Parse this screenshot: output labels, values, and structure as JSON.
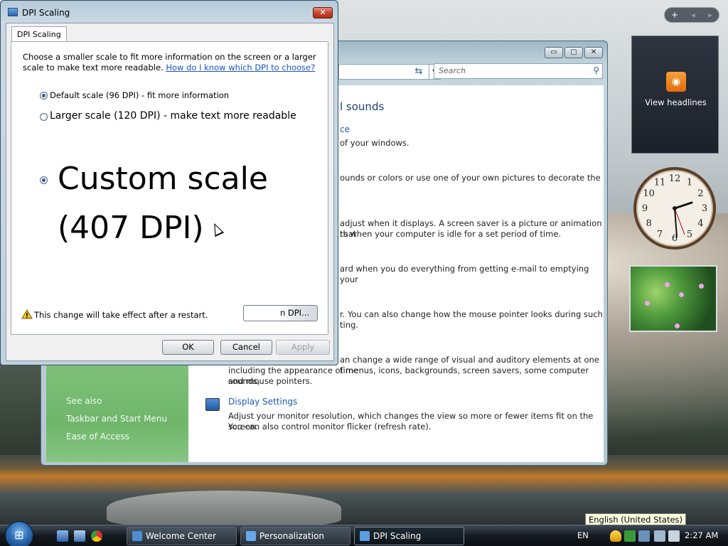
{
  "colors": {
    "link": "#1d5ab0",
    "dialog_link": "#1a55c0",
    "close_button": "#c8452e",
    "feed_icon": "#e36b0c",
    "sidebar_green": "#6fb66a",
    "taskbar": "#141a20"
  },
  "control_panel": {
    "search_placeholder": "Search",
    "heading": "l sounds",
    "window_color_link": "ce",
    "window_color_desc": "of your windows.",
    "background_desc": "ounds or colors or use one of your own pictures to decorate the",
    "screensaver_desc_1": "adjust when it displays. A screen saver is a picture or animation that",
    "screensaver_desc_2": "rs when your computer is idle for a set period of time.",
    "sounds_desc": "ard when you do everything from getting e-mail to emptying your",
    "mouse_desc_1": "r. You can also change how the mouse pointer looks during such",
    "mouse_desc_2": "ting.",
    "theme_desc_1": "an change a wide range of visual and auditory elements at one time",
    "theme_desc_2": "including the appearance of menus, icons, backgrounds, screen savers, some computer sounds,",
    "theme_desc_3": "and mouse pointers.",
    "display_settings_link": "Display Settings",
    "display_desc_1": "Adjust your monitor resolution, which changes the view so more or fewer items fit on the screen.",
    "display_desc_2": "You can also control monitor flicker (refresh rate).",
    "see_also": "See also",
    "see_also_links": [
      "Taskbar and Start Menu",
      "Ease of Access"
    ]
  },
  "gadgets": {
    "feed_label": "View headlines",
    "clock_numbers": [
      "12",
      "1",
      "2",
      "3",
      "4",
      "5",
      "6",
      "7",
      "8",
      "9",
      "10",
      "11"
    ]
  },
  "dpi_dialog": {
    "title": "DPI Scaling",
    "tab": "DPI Scaling",
    "description": "Choose a smaller scale to fit more information on the screen or a larger scale to make text more readable.",
    "help_link": "How do I know which DPI to choose?",
    "options": [
      {
        "label": "Default scale (96 DPI) - fit more information",
        "checked": true
      },
      {
        "label": "Larger scale (120 DPI) - make text more readable",
        "checked": false
      }
    ],
    "custom_line1": "Custom scale",
    "custom_line2": "(407 DPI)",
    "warning": "This change will take effect after a restart.",
    "custom_dpi_button": "n DPI...",
    "ok": "OK",
    "cancel": "Cancel",
    "apply": "Apply"
  },
  "taskbar": {
    "tasks": [
      "Welcome Center",
      "Personalization",
      "DPI Scaling"
    ],
    "language": "EN",
    "time": "2:27 AM",
    "language_tooltip": "English (United States)"
  }
}
